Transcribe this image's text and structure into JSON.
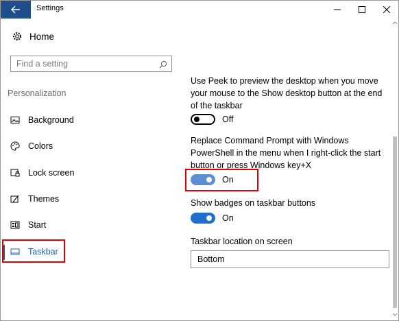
{
  "window": {
    "title": "Settings"
  },
  "sidebar": {
    "home_label": "Home",
    "search_placeholder": "Find a setting",
    "section_label": "Personalization",
    "items": [
      {
        "label": "Background",
        "icon": "background-icon"
      },
      {
        "label": "Colors",
        "icon": "palette-icon"
      },
      {
        "label": "Lock screen",
        "icon": "lock-screen-icon"
      },
      {
        "label": "Themes",
        "icon": "themes-icon"
      },
      {
        "label": "Start",
        "icon": "start-icon"
      },
      {
        "label": "Taskbar",
        "icon": "taskbar-icon",
        "active": true
      }
    ]
  },
  "main": {
    "peek_text": "Use Peek to preview the desktop when you move your mouse to the Show desktop button at the end of the taskbar",
    "peek_state": "Off",
    "powershell_text": "Replace Command Prompt with Windows PowerShell in the menu when I right-click the start button or press Windows key+X",
    "powershell_state": "On",
    "badges_text": "Show badges on taskbar buttons",
    "badges_state": "On",
    "location_label": "Taskbar location on screen",
    "location_value": "Bottom"
  },
  "colors": {
    "accent": "#1f6fcc",
    "titlebar_back": "#1f4e8c",
    "highlight": "#e00000"
  }
}
